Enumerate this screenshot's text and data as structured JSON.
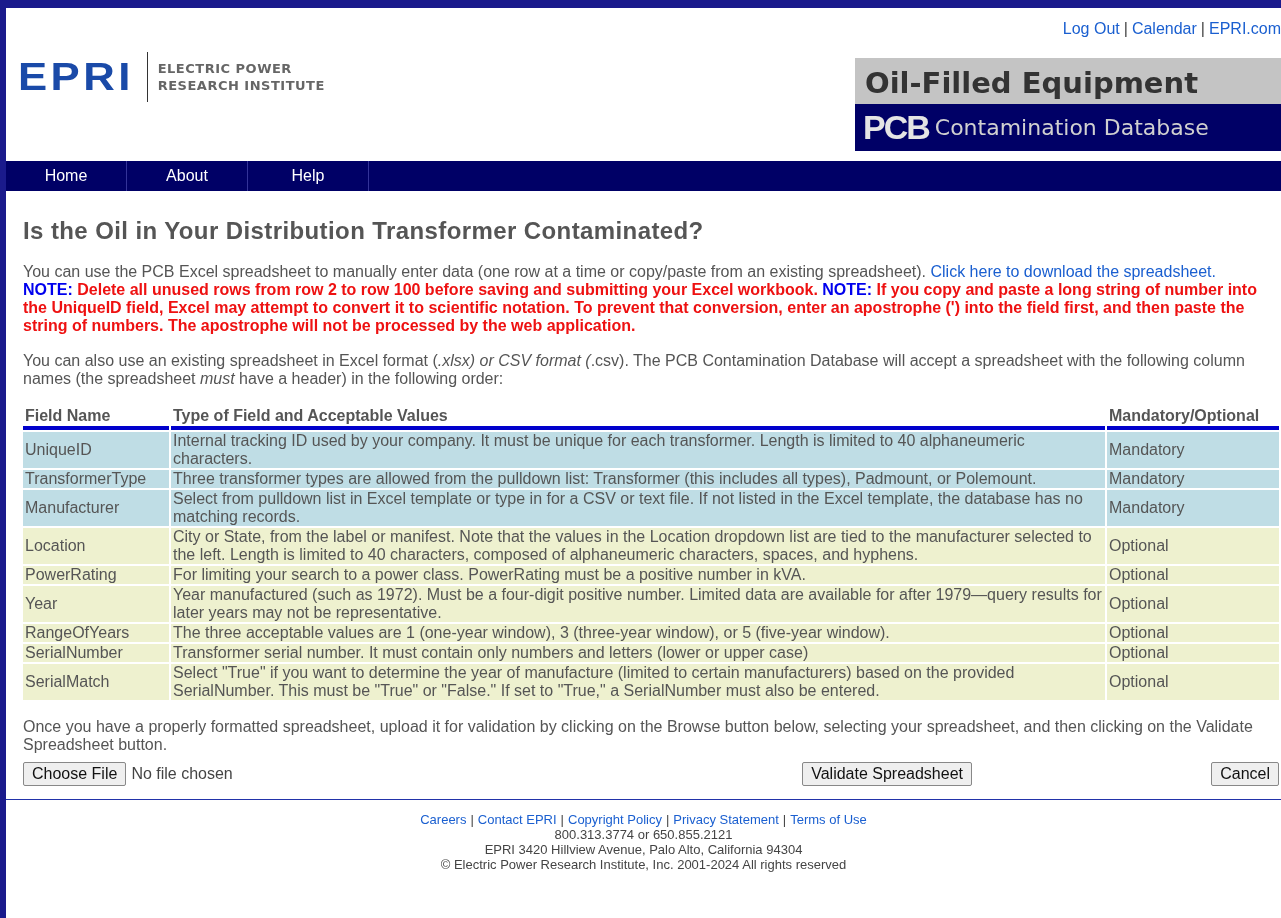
{
  "top_links": [
    "Log Out",
    "Calendar",
    "EPRI.com"
  ],
  "link_separator": "|",
  "logo": {
    "mark": "EPRI",
    "line_1": "ELECTRIC POWER",
    "line_2": "RESEARCH INSTITUTE"
  },
  "banner": {
    "line_1": "Oil-Filled Equipment",
    "acronym": "PCB",
    "line_2": "Contamination Database"
  },
  "nav": [
    {
      "label": "Home"
    },
    {
      "label": "About"
    },
    {
      "label": "Help"
    }
  ],
  "heading": "Is the Oil in Your Distribution Transformer Contaminated?",
  "intro": [
    {
      "kind": "plain",
      "text": "You can use the PCB Excel spreadsheet to manually enter data (one row at a time or copy/paste from an existing spreadsheet). "
    },
    {
      "kind": "link",
      "text": "Click here to download the spreadsheet."
    },
    {
      "kind": "note_label",
      "text": "NOTE:"
    },
    {
      "kind": "note",
      "text": " Delete all unused rows from row 2 to row 100 before saving and submitting your Excel workbook. "
    },
    {
      "kind": "note_label",
      "text": "NOTE:"
    },
    {
      "kind": "note",
      "text": " If you copy and paste a long string of number into the UniqueID field, Excel may attempt to convert it to scientific notation. To prevent that conversion, enter an apostrophe (') into the field first, and then paste the string of numbers. The apostrophe will not be processed by the web application."
    }
  ],
  "formats_text": "You can also use an existing spreadsheet in Excel format (*.xlsx) or CSV format (*.csv). The PCB Contamination Database will accept a spreadsheet with the following column names (the spreadsheet *must* have a header) in the following order:",
  "table": {
    "columns": [
      "Field Name",
      "Type of Field and Acceptable Values",
      "Mandatory/Optional"
    ],
    "rows": [
      {
        "kind": "mandatory",
        "cells": [
          "UniqueID",
          "Internal tracking ID used by your company. It must be unique for each transformer. Length is limited to 40 alphaneumeric characters.",
          "Mandatory"
        ]
      },
      {
        "kind": "mandatory",
        "cells": [
          "TransformerType",
          "Three transformer types are allowed from the pulldown list: Transformer (this includes all types), Padmount, or Polemount.",
          "Mandatory"
        ]
      },
      {
        "kind": "mandatory",
        "cells": [
          "Manufacturer",
          "Select from pulldown list in Excel template or type in for a CSV or text file. If not listed in the Excel template, the database has no matching records.",
          "Mandatory"
        ]
      },
      {
        "kind": "optional",
        "cells": [
          "Location",
          "City or State, from the label or manifest. Note that the values in the Location dropdown list are tied to the manufacturer selected to the left. Length is limited to 40 characters, composed of alphaneumeric characters, spaces, and hyphens.",
          "Optional"
        ]
      },
      {
        "kind": "optional",
        "cells": [
          "PowerRating",
          "For limiting your search to a power class. PowerRating must be a positive number in kVA.",
          "Optional"
        ]
      },
      {
        "kind": "optional",
        "cells": [
          "Year",
          "Year manufactured (such as 1972). Must be a four-digit positive number. Limited data are available for after 1979—query results for later years may not be representative.",
          "Optional"
        ]
      },
      {
        "kind": "optional",
        "cells": [
          "RangeOfYears",
          "The three acceptable values are 1 (one-year window), 3 (three-year window), or 5 (five-year window).",
          "Optional"
        ]
      },
      {
        "kind": "optional",
        "cells": [
          "SerialNumber",
          "Transformer serial number. It must contain only numbers and letters (lower or upper case)",
          "Optional"
        ]
      },
      {
        "kind": "optional",
        "cells": [
          "SerialMatch",
          "Select \"True\" if you want to determine the year of manufacture (limited to certain manufacturers) based on the provided SerialNumber. This must be \"True\" or \"False.\" If set to \"True,\" a SerialNumber must also be entered.",
          "Optional"
        ]
      }
    ]
  },
  "upload_text": "Once you have a properly formatted spreadsheet, upload it for validation by clicking on the Browse button below, selecting your spreadsheet, and then clicking on the Validate Spreadsheet button.",
  "file_button": "Choose File",
  "file_status": "No file chosen",
  "validate_button": "Validate Spreadsheet",
  "cancel_button": "Cancel",
  "footer": {
    "separator": "|",
    "links": [
      "Careers",
      "Contact EPRI",
      "Copyright Policy",
      "Privacy Statement",
      "Terms of Use"
    ],
    "lines": [
      "800.313.3774 or 650.855.2121",
      "EPRI 3420 Hillview Avenue, Palo Alto, California 94304",
      "© Electric Power Research Institute, Inc. 2001-2024 All rights reserved"
    ]
  }
}
